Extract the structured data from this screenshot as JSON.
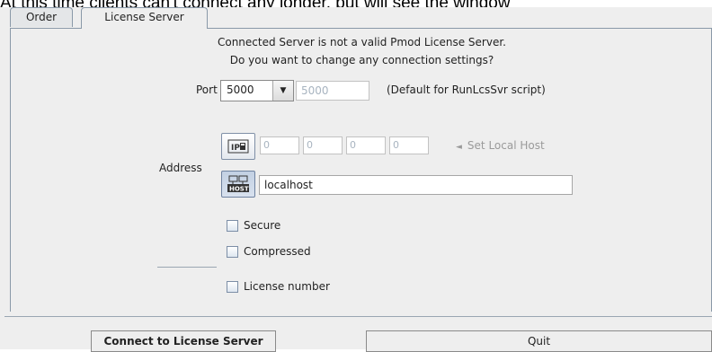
{
  "doc_text": "At this time clients can't connect any longer, but will see the window",
  "tabs": [
    {
      "label": "Order",
      "active": false
    },
    {
      "label": "License Server",
      "active": true
    }
  ],
  "message": {
    "line1": "Connected Server is not a valid Pmod License Server.",
    "line2": "Do you want to change any connection settings?"
  },
  "port": {
    "label": "Port",
    "selected": "5000",
    "field_value": "5000",
    "hint": "(Default for RunLcsSvr script)"
  },
  "address": {
    "label": "Address",
    "ip_icon": "ip-address-icon",
    "ip_octets": [
      "0",
      "0",
      "0",
      "0"
    ],
    "set_local_host": "Set Local Host",
    "host_icon": "host-icon",
    "host_value": "localhost"
  },
  "options": {
    "secure": {
      "label": "Secure",
      "checked": false
    },
    "compressed": {
      "label": "Compressed",
      "checked": false
    },
    "license_number": {
      "label": "License number",
      "checked": false
    }
  },
  "buttons": {
    "connect": "Connect to License Server",
    "quit": "Quit"
  },
  "colors": {
    "panel_bg": "#eeeeee",
    "border": "#8a99a8",
    "dim_text": "#a8b4c0"
  }
}
